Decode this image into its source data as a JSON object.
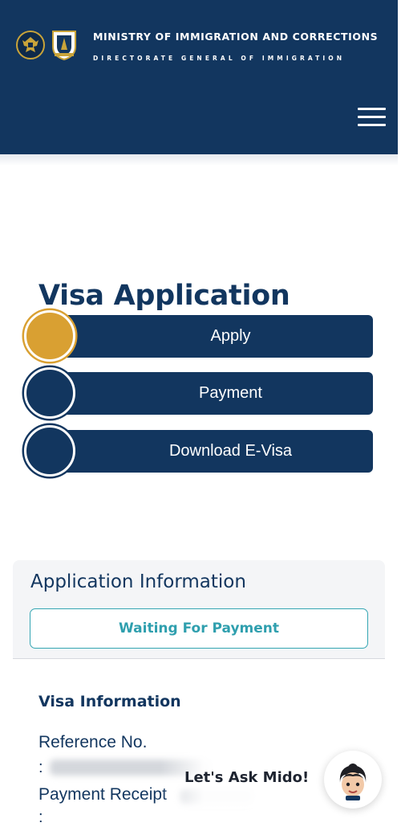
{
  "header": {
    "ministry": "MINISTRY OF IMMIGRATION AND CORRECTIONS",
    "directorate": "DIRECTORATE GENERAL OF IMMIGRATION",
    "logos": [
      "garuda-emblem-logo",
      "immigration-emblem-logo"
    ],
    "menu_icon": "hamburger-menu-icon"
  },
  "visa_application": {
    "title": "Visa Application",
    "steps": [
      {
        "label": "Apply",
        "active": true
      },
      {
        "label": "Payment",
        "active": false
      },
      {
        "label": "Download E-Visa",
        "active": false
      }
    ]
  },
  "application_information": {
    "title": "Application Information",
    "status": "Waiting For Payment"
  },
  "visa_information": {
    "heading": "Visa Information",
    "reference_label": "Reference No.",
    "reference_colon": ":",
    "payment_receipt_label": "Payment Receipt",
    "payment_receipt_colon": ":"
  },
  "chat": {
    "label": "Let's Ask Mido!",
    "avatar_icon": "mido-assistant-avatar"
  },
  "colors": {
    "primary_navy": "#12365f",
    "active_step": "#d9a032",
    "status_teal": "#2f9fae",
    "card_background": "#f4f5f7"
  }
}
